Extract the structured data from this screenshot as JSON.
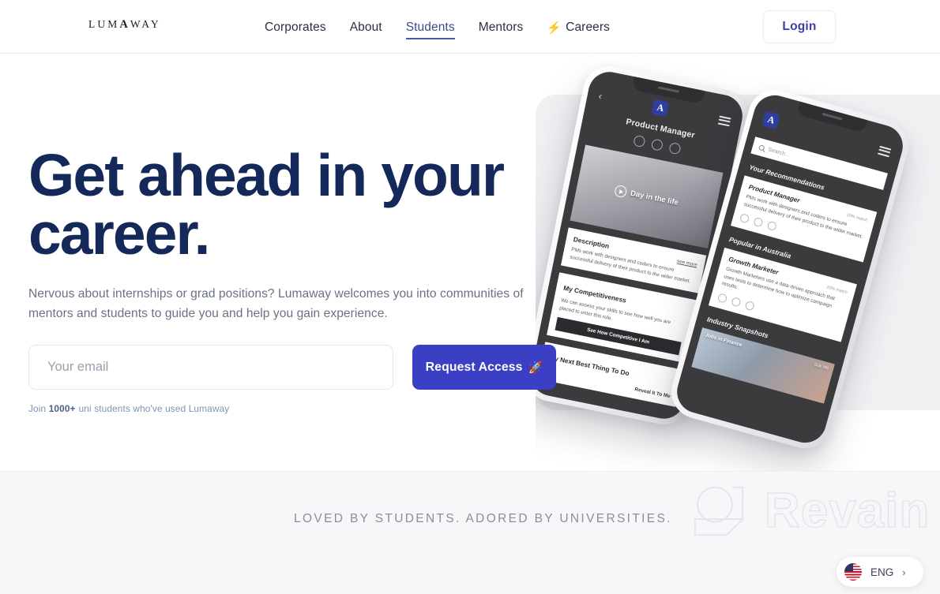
{
  "brand": {
    "name": "LUMAWAY",
    "letters_pre": "LUM",
    "letter_a": "A",
    "letters_post": "WAY"
  },
  "nav": {
    "items": [
      {
        "label": "Corporates",
        "active": false,
        "emoji": ""
      },
      {
        "label": "About",
        "active": false,
        "emoji": ""
      },
      {
        "label": "Students",
        "active": true,
        "emoji": ""
      },
      {
        "label": "Mentors",
        "active": false,
        "emoji": ""
      },
      {
        "label": "Careers",
        "active": false,
        "emoji": "⚡"
      }
    ],
    "login_label": "Login"
  },
  "hero": {
    "title_line1": "Get ahead in your",
    "title_line2": "career.",
    "subtitle": "Nervous about internships or grad positions? Lumaway welcomes you into communities of mentors and students to guide you and help you gain experience.",
    "email_placeholder": "Your email",
    "email_value": "",
    "cta_label": "Request Access",
    "cta_emoji": "🚀",
    "join_prefix": "Join",
    "join_count": "1000+",
    "join_suffix": "uni students who've used Lumaway",
    "title_color": "#14295a",
    "cta_color": "#3a3fc4"
  },
  "mockup": {
    "phone_left": {
      "back_icon": "‹",
      "app_logo": "A",
      "menu_icon": "hamburger",
      "screen_title": "Product Manager",
      "video_label": "Day in the life",
      "cards": [
        {
          "title": "Description",
          "link": "see more",
          "body": "PMs work with designers and coders to ensure successful delivery of their product to the wider market."
        },
        {
          "title": "My Competitiveness",
          "body": "We can assess your skills to see how well you are placed to enter this role.",
          "button": "See How Competitive I Am"
        },
        {
          "title": "My Next Best Thing To Do",
          "button_ghost": "Reveal It To Me"
        }
      ]
    },
    "phone_right": {
      "app_logo": "A",
      "menu_icon": "hamburger",
      "search_placeholder": "Search...",
      "sections": [
        {
          "heading": "Your Recommendations",
          "card_title": "Product Manager",
          "card_meta": "20% match",
          "card_body": "PMs work with designers and coders to ensure successful delivery of their product to the wider market."
        },
        {
          "heading": "Popular in Australia",
          "card_title": "Growth Marketer",
          "card_meta": "20% match",
          "card_body": "Growth Marketers use a data-driven approach that uses tests to determine how to optimize campaign results."
        }
      ],
      "snapshot_heading": "Industry Snapshots",
      "snapshot_label": "Jobs in Finance",
      "snapshot_meta": "Sub Me"
    }
  },
  "band": {
    "title": "LOVED BY STUDENTS. ADORED BY UNIVERSITIES.",
    "partner_logo": "Revain"
  },
  "language": {
    "flag": "us-flag-icon",
    "label": "ENG",
    "chevron": "›"
  }
}
